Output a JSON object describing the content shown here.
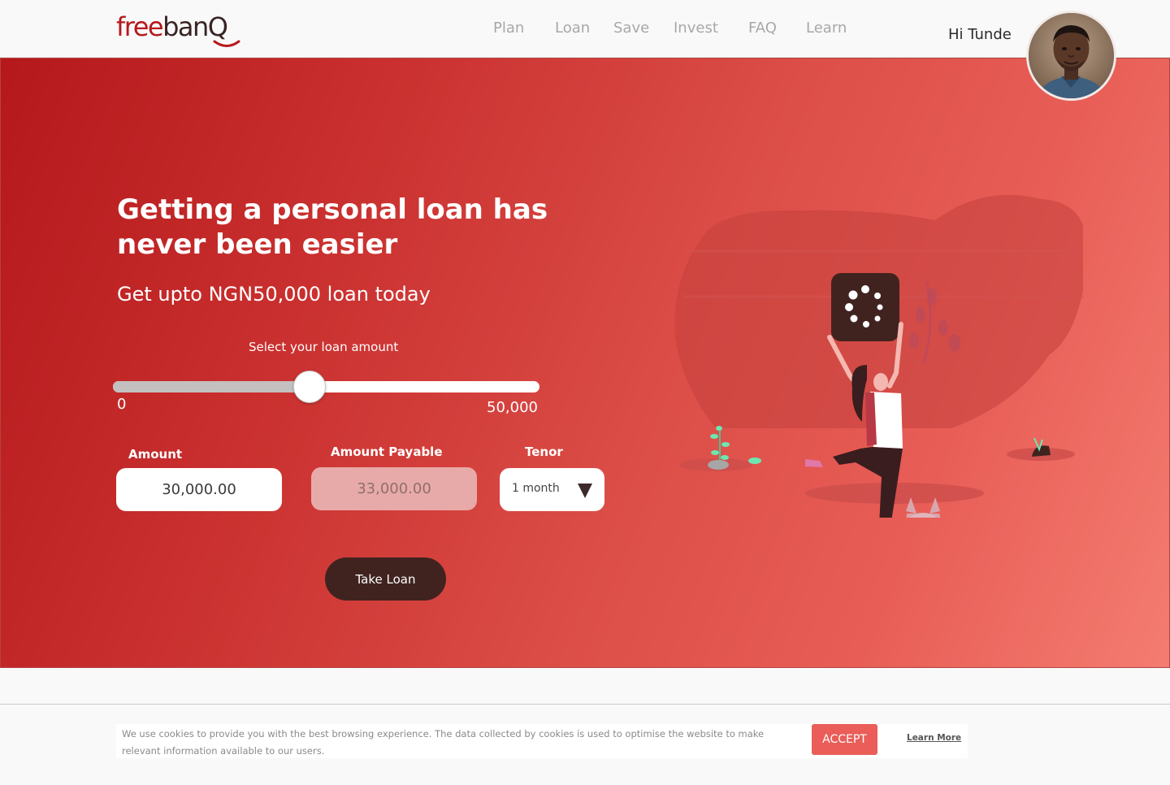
{
  "brand": {
    "part1": "free",
    "part2": "banQ",
    "accent": "#b7191c",
    "dark": "#3a2424"
  },
  "nav": {
    "items": [
      {
        "label": "Plan"
      },
      {
        "label": "Loan"
      },
      {
        "label": "Save"
      },
      {
        "label": "Invest"
      },
      {
        "label": "FAQ"
      },
      {
        "label": "Learn"
      }
    ]
  },
  "user": {
    "greeting": "Hi Tunde"
  },
  "hero": {
    "title": "Getting a personal loan has never been easier",
    "subtitle": "Get upto NGN50,000 loan today",
    "slider": {
      "caption": "Select your loan amount",
      "min_label": "0",
      "max_label": "50,000",
      "min": 0,
      "max": 50000,
      "value": 23000
    },
    "form": {
      "amount_label": "Amount",
      "amount_value": "30,000.00",
      "payable_label": "Amount Payable",
      "payable_value": "33,000.00",
      "tenor_label": "Tenor",
      "tenor_value": "1 month"
    },
    "cta": "Take Loan",
    "gradient_start": "#b5181b",
    "gradient_end": "#f47c70"
  },
  "cookie": {
    "text": "We use cookies to provide you with the best browsing experience. The data collected by cookies is used to optimise the website to make relevant information available to our users.",
    "accept": "ACCEPT",
    "learn_more": "Learn More"
  }
}
